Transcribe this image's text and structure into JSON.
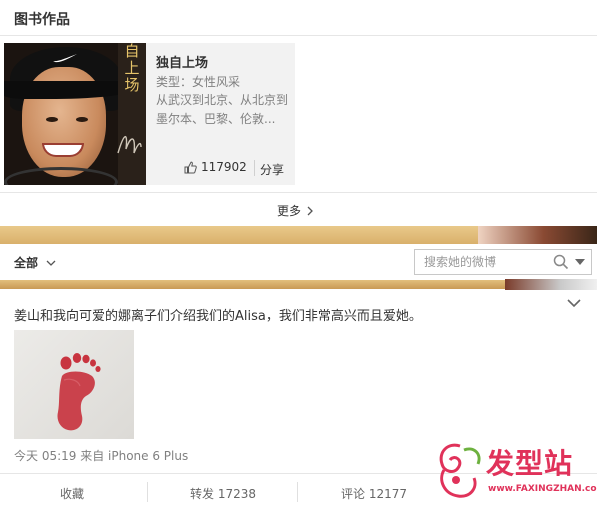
{
  "books_section": {
    "title": "图书作品",
    "book": {
      "cover_text": "自上场",
      "title": "独自上场",
      "type": "类型：女性风采",
      "description": "从武汉到北京、从北京到墨尔本、巴黎、伦敦...",
      "likes": "117902",
      "share_label": "分享"
    },
    "more_label": "更多"
  },
  "filter": {
    "tab_label": "全部",
    "search_placeholder": "搜索她的微博"
  },
  "post": {
    "text": "姜山和我向可爱的娜离子们介绍我们的Alisa，我们非常高兴而且爱她。",
    "meta": "今天 05:19 来自 iPhone 6 Plus",
    "actions": {
      "favorite": "收藏",
      "repost": "转发 17238",
      "comment": "评论 12177"
    }
  },
  "watermark": {
    "title": "发型站",
    "url": "www.FAXINGZHAN.com"
  },
  "colors": {
    "banner_gold": "#d9b06b",
    "watermark_pink": "#e0325a",
    "footprint_red": "#c8343f"
  }
}
